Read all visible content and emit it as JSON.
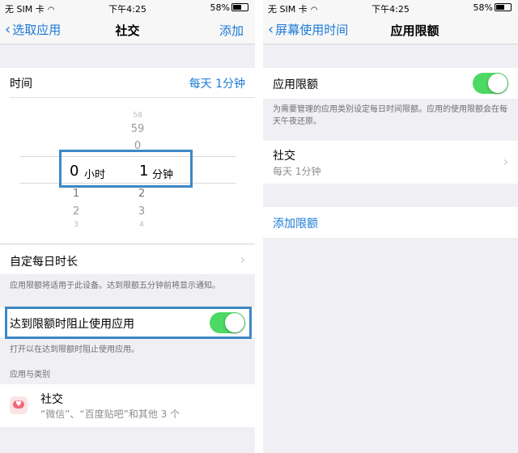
{
  "status_bar": {
    "carrier": "无 SIM 卡",
    "time": "下午4:25",
    "battery": "58%"
  },
  "left": {
    "nav": {
      "back": "选取应用",
      "title": "社交",
      "action": "添加"
    },
    "time_row": {
      "label": "时间",
      "value": "每天 1分钟"
    },
    "picker": {
      "hours": [
        "58",
        "59",
        "0",
        "1",
        "2",
        "3"
      ],
      "selected_hours": "0",
      "hours_unit": "小时",
      "minutes": [
        "",
        "",
        "",
        "1",
        "2",
        "3"
      ],
      "selected_minutes": "1",
      "minutes_unit": "分钟",
      "hours_above": [
        "58",
        "59",
        "0"
      ],
      "hours_below": [
        "1",
        "2",
        "3"
      ],
      "minutes_below": [
        "2",
        "3",
        "4"
      ]
    },
    "custom_row": {
      "label": "自定每日时长"
    },
    "note1": "应用限额将适用于此设备。达到限额五分钟前将显示通知。",
    "block_row": {
      "label": "达到限额时阻止使用应用",
      "on": true
    },
    "note2": "打开以在达到限额时阻止使用应用。",
    "section_header": "应用与类别",
    "app_row": {
      "name": "社交",
      "detail": "“微信”、“百度贴吧”和其他 3 个",
      "icon": "social-chat-icon"
    }
  },
  "right": {
    "nav": {
      "back": "屏幕使用时间",
      "title": "应用限额"
    },
    "limit_row": {
      "label": "应用限额",
      "on": true
    },
    "note": "为需要管理的应用类别设定每日时间限额。应用的使用限额会在每天午夜还原。",
    "category_row": {
      "label": "社交",
      "detail": "每天 1分钟"
    },
    "add_row": {
      "label": "添加限额"
    }
  },
  "colors": {
    "accent": "#1b7ad6",
    "toggle_on": "#4cd964",
    "highlight": "#3d88c4"
  }
}
